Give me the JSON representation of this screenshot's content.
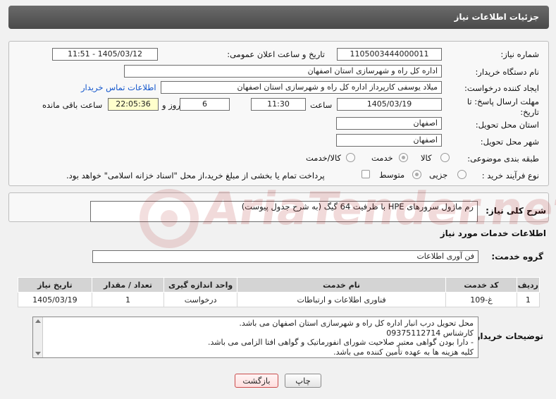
{
  "header": {
    "title": "جزئیات اطلاعات نیاز"
  },
  "labels": {
    "need_number": "شماره نیاز:",
    "announce_datetime": "تاریخ و ساعت اعلان عمومی:",
    "buyer_org": "نام دستگاه خریدار:",
    "requester": "ایجاد کننده درخواست:",
    "deadline": "مهلت ارسال پاسخ: تا تاریخ:",
    "hour": "ساعت",
    "day_and": "روز و",
    "remaining": "ساعت باقی مانده",
    "delivery_province": "استان محل تحویل:",
    "delivery_city": "شهر محل تحویل:",
    "category": "طبقه بندی موضوعی:",
    "purchase_type": "نوع فرآیند خرید :",
    "general_desc": "شرح کلی نیاز:",
    "services_info": "اطلاعات خدمات مورد نیاز",
    "service_group": "گروه خدمت:",
    "buyer_notes": "توضیحات خریدار:"
  },
  "fields": {
    "need_number": "1105003444000011",
    "announce_datetime": "1405/03/12 - 11:51",
    "buyer_org": "اداره کل راه و شهرسازی استان اصفهان",
    "requester": "میلاد یوسفی کارپرداز اداره کل راه و شهرسازی استان اصفهان",
    "contact_link": "اطلاعات تماس خریدار",
    "deadline_date": "1405/03/19",
    "deadline_time": "11:30",
    "days": "6",
    "remaining_time": "22:05:36",
    "delivery_province": "اصفهان",
    "delivery_city": "اصفهان",
    "general_desc": "رم ماژول سرورهای HPE با ظرفیت 64 گیگ (به شرح جدول پیوست)",
    "service_group": "فن آوری اطلاعات"
  },
  "category_options": [
    {
      "label": "کالا",
      "selected": false
    },
    {
      "label": "خدمت",
      "selected": true
    },
    {
      "label": "کالا/خدمت",
      "selected": false
    }
  ],
  "purchase_options": [
    {
      "label": "جزیی",
      "selected": false
    },
    {
      "label": "متوسط",
      "selected": true
    }
  ],
  "payment_note": "پرداخت تمام یا بخشی از مبلغ خرید،از محل \"اسناد خزانه اسلامی\" خواهد بود.",
  "table": {
    "headers": [
      "ردیف",
      "کد خدمت",
      "نام خدمت",
      "واحد اندازه گیری",
      "تعداد / مقدار",
      "تاریخ نیاز"
    ],
    "rows": [
      [
        "1",
        "غ-109",
        "فناوری اطلاعات و ارتباطات",
        "درخواست",
        "1",
        "1405/03/19"
      ]
    ]
  },
  "notes": [
    "محل تحویل درب انبار اداره کل راه و شهرسازی استان اصفهان می باشد.",
    "کارشناس 09375112714",
    "- دارا بودن گواهی معتبر صلاحیت شورای انفورماتیک و گواهی افتا الزامی می باشد.",
    "کلیه هزینه ها به عهده تأمین کننده می باشد."
  ],
  "buttons": {
    "print": "چاپ",
    "back": "بازگشت"
  },
  "watermark": "AriaTender.net"
}
